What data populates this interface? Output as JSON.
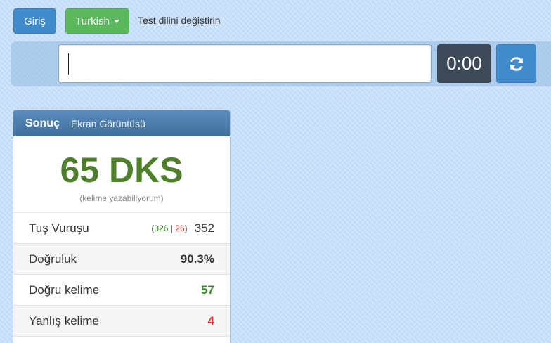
{
  "toolbar": {
    "login_label": "Giriş",
    "language_label": "Turkish",
    "language_hint": "Test dilini değiştirin"
  },
  "typing": {
    "input_value": "",
    "timer": "0:00",
    "reload_icon": "refresh-icon"
  },
  "result": {
    "title": "Sonuç",
    "screenshot_link": "Ekran Görüntüsü",
    "wpm": "65 DKS",
    "wpm_caption": "(kelime yazabiliyorum)",
    "keystrokes": {
      "label": "Tuş Vuruşu",
      "open": "(",
      "correct": "326",
      "sep": "|",
      "wrong": "26",
      "close": ")",
      "total": "352"
    },
    "accuracy": {
      "label": "Doğruluk",
      "value": "90.3%"
    },
    "correct_words": {
      "label": "Doğru kelime",
      "value": "57"
    },
    "wrong_words": {
      "label": "Yanlış kelime",
      "value": "4"
    }
  },
  "colors": {
    "background": "#c2dcf7",
    "primary": "#428bca",
    "success": "#5cb85c",
    "timer_bg": "#3c4a58",
    "wpm_green": "#4f7f2d",
    "correct_green": "#3a8a2a",
    "error_red": "#d9342b"
  }
}
